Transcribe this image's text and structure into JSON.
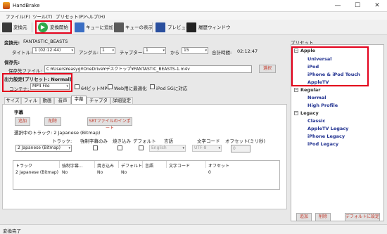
{
  "app": {
    "title": "HandBrake"
  },
  "menu": [
    "ファイル(F)",
    "ツール(T)",
    "プリセット(P)",
    "ヘルプ(H)"
  ],
  "toolbar": {
    "source": "変換元",
    "start": "変換開始",
    "add_queue": "キューに追加",
    "show_queue": "キューの表示",
    "preview": "プレビュー",
    "activity": "履歴ウィンドウ"
  },
  "source": {
    "label": "変換元:",
    "value": "FANTASTIC_BEASTS"
  },
  "title_row": {
    "title_label": "タイトル:",
    "title_value": "1 (02:12:44)",
    "angle_label": "アングル:",
    "angle_value": "1",
    "chapter_label": "チャプター:",
    "chapter_from": "1",
    "from_label": "から",
    "chapter_to": "15",
    "duration_label": "合計時間:",
    "duration_value": "02:12:47"
  },
  "destination": {
    "heading": "保存先:",
    "file_label": "保存先ファイル:",
    "file_value": "C:¥Users¥easyg¥OneDrive¥デスクトップ¥FANTASTIC_BEASTS-1.m4v",
    "browse": "選択"
  },
  "output": {
    "heading": "出力設定(プリセット: Normal)",
    "container_label": "コンテナ:",
    "container_value": "MP4 File",
    "opt_64bit": "64ビットMP4",
    "opt_web": "Web用に最適化",
    "opt_ipod": "iPod 5Gに対応"
  },
  "tabs": [
    "サイズ",
    "フィルタ",
    "動画",
    "音声",
    "字幕",
    "チャプター",
    "詳細設定"
  ],
  "subtitles": {
    "heading": "字幕",
    "add": "追加",
    "remove": "削除",
    "import_srt": "SRTファイルのインポート",
    "selected_track": "選択中のトラック: 2 Japanese (Bitmap)",
    "track_label": "トラック:",
    "track_value": "2 Japanese (Bitmap)",
    "forced_label": "強制字幕のみ",
    "burned_label": "焼き込み",
    "default_label": "デフォルト",
    "lang_label": "言語",
    "lang_value": "English",
    "charcode_label": "文字コード",
    "charcode_value": "UTF-8",
    "offset_label": "オフセット(ミリ秒)",
    "offset_value": "0",
    "columns": [
      "トラック",
      "強制字幕...",
      "焼き込み",
      "デフォルト",
      "言語",
      "文字コード",
      "オフセット"
    ],
    "rows": [
      [
        "2 Japanese (Bitmap)",
        "No",
        "No",
        "No",
        "",
        "",
        "0"
      ]
    ]
  },
  "presets": {
    "heading": "プリセット",
    "groups": [
      {
        "name": "Apple",
        "items": [
          "Universal",
          "iPod",
          "iPhone & iPod Touch",
          "AppleTV"
        ]
      },
      {
        "name": "Regular",
        "items": [
          "Normal",
          "High Profile"
        ]
      },
      {
        "name": "Legacy",
        "items": [
          "Classic",
          "AppleTV Legacy",
          "iPhone Legacy",
          "iPod Legacy"
        ]
      }
    ],
    "add": "追加",
    "remove": "削除",
    "set_default": "デフォルトに設定"
  },
  "status": "変換完了",
  "colors": {
    "highlight": "#e3001b",
    "preset_text": "#1e2f8f",
    "button_text": "#c0392b"
  }
}
